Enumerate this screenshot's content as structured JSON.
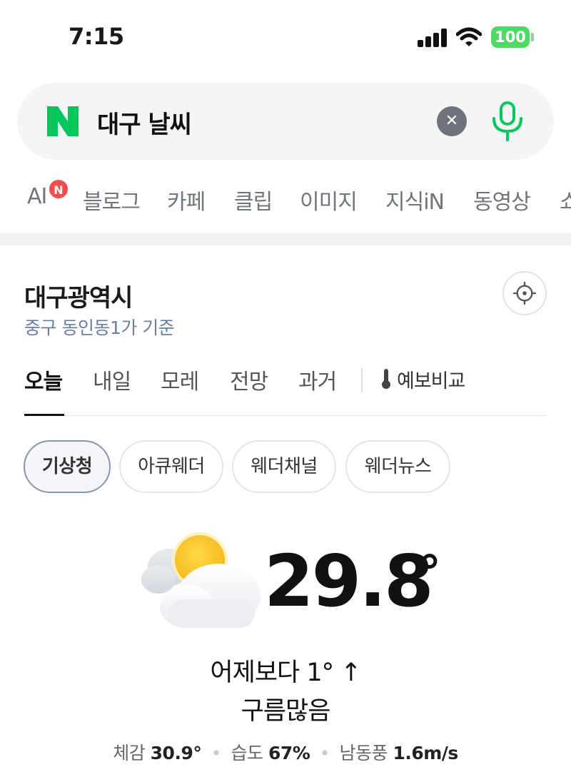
{
  "status_bar": {
    "time": "7:15",
    "battery": "100"
  },
  "search": {
    "query": "대구 날씨"
  },
  "tabs": [
    {
      "label": "AI",
      "badge": "N"
    },
    {
      "label": "블로그"
    },
    {
      "label": "카페"
    },
    {
      "label": "클립"
    },
    {
      "label": "이미지"
    },
    {
      "label": "지식iN"
    },
    {
      "label": "동영상"
    },
    {
      "label": "쇼"
    }
  ],
  "weather": {
    "city": "대구광역시",
    "basis": "중구 동인동1가 기준",
    "day_tabs": [
      "오늘",
      "내일",
      "모레",
      "전망",
      "과거"
    ],
    "compare_label": "예보비교",
    "providers": [
      "기상청",
      "아큐웨더",
      "웨더채널",
      "웨더뉴스"
    ],
    "selected_provider": "기상청",
    "temperature": "29.8",
    "temperature_unit": "°",
    "vs_yesterday": "어제보다 1° ↑",
    "condition": "구름많음",
    "details": {
      "feels_label": "체감",
      "feels_value": "30.9°",
      "humidity_label": "습도",
      "humidity_value": "67%",
      "wind_label": "남동풍",
      "wind_value": "1.6m/s"
    }
  },
  "colors": {
    "naver_green": "#03c75a",
    "battery_green": "#4cd964",
    "badge_red": "#f04d4d"
  }
}
